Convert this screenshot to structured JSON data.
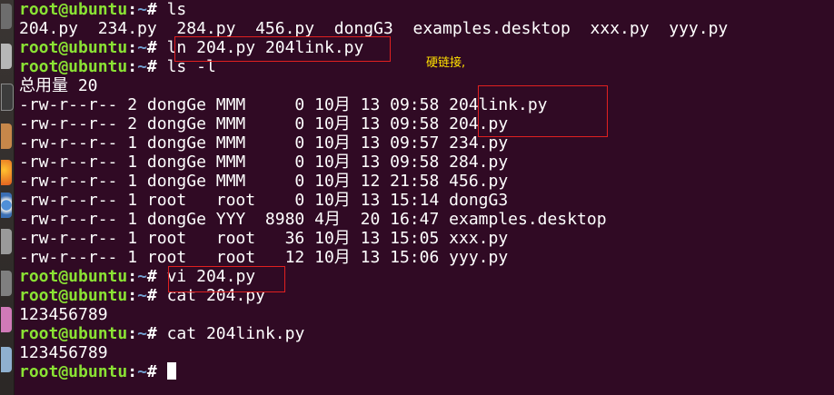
{
  "prompt": {
    "user": "root@ubuntu",
    "colon": ":",
    "path": "~",
    "symbol": "# "
  },
  "lines": [
    {
      "type": "prompt",
      "cmd": "ls"
    },
    {
      "type": "output",
      "text": "204.py  234.py  284.py  456.py  dongG3  examples.desktop  xxx.py  yyy.py"
    },
    {
      "type": "prompt",
      "cmd": "ln 204.py 204link.py"
    },
    {
      "type": "prompt",
      "cmd": "ls -l"
    },
    {
      "type": "output",
      "text": "总用量 20"
    },
    {
      "type": "output",
      "text": "-rw-r--r-- 2 dongGe MMM     0 10月 13 09:58 204link.py"
    },
    {
      "type": "output",
      "text": "-rw-r--r-- 2 dongGe MMM     0 10月 13 09:58 204.py"
    },
    {
      "type": "output",
      "text": "-rw-r--r-- 1 dongGe MMM     0 10月 13 09:57 234.py"
    },
    {
      "type": "output",
      "text": "-rw-r--r-- 1 dongGe MMM     0 10月 13 09:58 284.py"
    },
    {
      "type": "output",
      "text": "-rw-r--r-- 1 dongGe MMM     0 10月 12 21:58 456.py"
    },
    {
      "type": "output",
      "text": "-rw-r--r-- 1 root   root    0 10月 13 15:14 dongG3"
    },
    {
      "type": "output",
      "text": "-rw-r--r-- 1 dongGe YYY  8980 4月  20 16:47 examples.desktop"
    },
    {
      "type": "output",
      "text": "-rw-r--r-- 1 root   root   36 10月 13 15:05 xxx.py"
    },
    {
      "type": "output",
      "text": "-rw-r--r-- 1 root   root   12 10月 13 15:06 yyy.py"
    },
    {
      "type": "prompt",
      "cmd": "vi 204.py"
    },
    {
      "type": "prompt",
      "cmd": "cat 204.py"
    },
    {
      "type": "output",
      "text": "123456789"
    },
    {
      "type": "prompt",
      "cmd": "cat 204link.py"
    },
    {
      "type": "output",
      "text": "123456789"
    },
    {
      "type": "prompt",
      "cmd": "",
      "cursor": true
    }
  ],
  "annotation": {
    "note": "硬链接,"
  },
  "colors": {
    "background": "#300a24",
    "prompt_user": "#8ae234",
    "prompt_path": "#729fcf",
    "annotation_text": "#ffe000",
    "annotation_box": "#e02020"
  },
  "launcher": {
    "icons": [
      "dash-icon",
      "files-icon",
      "terminal-icon",
      "software-center-icon",
      "firefox-icon",
      "chromium-icon",
      "settings-icon",
      "text-editor-icon",
      "workspace-icon",
      "app-icon"
    ]
  }
}
